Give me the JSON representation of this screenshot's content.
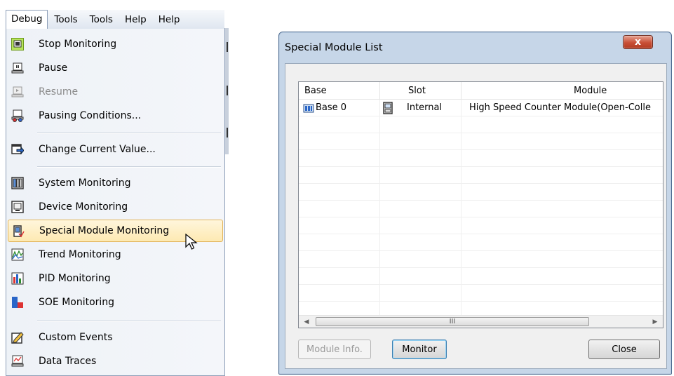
{
  "menubar": {
    "items": [
      {
        "label": "Debug"
      },
      {
        "label": "Tools"
      },
      {
        "label": "Tools"
      },
      {
        "label": "Help"
      },
      {
        "label": "Help"
      }
    ]
  },
  "debug_menu": {
    "items": [
      {
        "label": "Stop Monitoring",
        "icon": "stop-monitoring-icon"
      },
      {
        "label": "Pause",
        "icon": "pause-icon"
      },
      {
        "label": "Resume",
        "icon": "resume-icon",
        "disabled": true
      },
      {
        "label": "Pausing Conditions...",
        "icon": "pausing-conditions-icon"
      },
      {
        "label": "Change Current Value...",
        "icon": "change-value-icon"
      },
      {
        "label": "System Monitoring",
        "icon": "system-monitoring-icon"
      },
      {
        "label": "Device Monitoring",
        "icon": "device-monitoring-icon"
      },
      {
        "label": "Special Module Monitoring",
        "icon": "special-module-icon",
        "highlighted": true
      },
      {
        "label": "Trend Monitoring",
        "icon": "trend-monitoring-icon"
      },
      {
        "label": "PID Monitoring",
        "icon": "pid-monitoring-icon"
      },
      {
        "label": "SOE Monitoring",
        "icon": "soe-monitoring-icon"
      },
      {
        "label": "Custom Events",
        "icon": "custom-events-icon"
      },
      {
        "label": "Data Traces",
        "icon": "data-traces-icon"
      }
    ]
  },
  "dialog": {
    "title": "Special Module List",
    "close_glyph": "x",
    "columns": {
      "base": "Base",
      "slot": "Slot",
      "module": "Module"
    },
    "rows": [
      {
        "base": "Base 0",
        "slot": "Internal",
        "module": "High Speed Counter Module(Open-Colle"
      }
    ],
    "scroll_grip": "III",
    "buttons": {
      "module_info": "Module Info.",
      "monitor": "Monitor",
      "close": "Close"
    }
  }
}
